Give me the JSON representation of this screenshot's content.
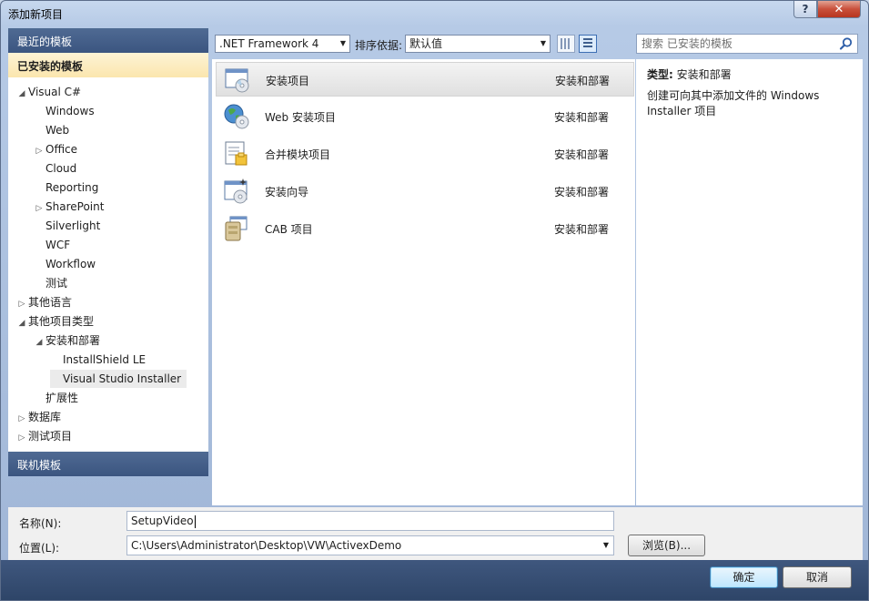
{
  "window": {
    "title": "添加新项目",
    "help_label": "?",
    "close_label": "✕"
  },
  "left": {
    "recent_header": "最近的模板",
    "installed_header": "已安装的模板",
    "online_header": "联机模板",
    "tree": [
      {
        "label": "Visual C#",
        "arrow": "◢",
        "level": 0
      },
      {
        "label": "Windows",
        "arrow": "",
        "level": 1
      },
      {
        "label": "Web",
        "arrow": "",
        "level": 1
      },
      {
        "label": "Office",
        "arrow": "▷",
        "level": 1
      },
      {
        "label": "Cloud",
        "arrow": "",
        "level": 1
      },
      {
        "label": "Reporting",
        "arrow": "",
        "level": 1
      },
      {
        "label": "SharePoint",
        "arrow": "▷",
        "level": 1
      },
      {
        "label": "Silverlight",
        "arrow": "",
        "level": 1
      },
      {
        "label": "WCF",
        "arrow": "",
        "level": 1
      },
      {
        "label": "Workflow",
        "arrow": "",
        "level": 1
      },
      {
        "label": "测试",
        "arrow": "",
        "level": 1
      },
      {
        "label": "其他语言",
        "arrow": "▷",
        "level": 0
      },
      {
        "label": "其他项目类型",
        "arrow": "◢",
        "level": 0
      },
      {
        "label": "安装和部署",
        "arrow": "◢",
        "level": 1
      },
      {
        "label": "InstallShield LE",
        "arrow": "",
        "level": 2
      },
      {
        "label": "Visual Studio Installer",
        "arrow": "",
        "level": 2,
        "selected": true
      },
      {
        "label": "扩展性",
        "arrow": "",
        "level": 1
      },
      {
        "label": "数据库",
        "arrow": "▷",
        "level": 0
      },
      {
        "label": "测试项目",
        "arrow": "▷",
        "level": 0
      }
    ]
  },
  "toolbar": {
    "framework": ".NET Framework 4",
    "sort_label": "排序依据:",
    "sort_value": "默认值"
  },
  "templates": [
    {
      "name": "安装项目",
      "category": "安装和部署",
      "icon": "setup-project-icon",
      "selected": true
    },
    {
      "name": "Web 安装项目",
      "category": "安装和部署",
      "icon": "web-setup-project-icon"
    },
    {
      "name": "合并模块项目",
      "category": "安装和部署",
      "icon": "merge-module-icon"
    },
    {
      "name": "安装向导",
      "category": "安装和部署",
      "icon": "setup-wizard-icon"
    },
    {
      "name": "CAB 项目",
      "category": "安装和部署",
      "icon": "cab-project-icon"
    }
  ],
  "search": {
    "placeholder": "搜索 已安装的模板"
  },
  "details": {
    "type_label": "类型:",
    "type_value": "安装和部署",
    "description": "创建可向其中添加文件的 Windows Installer 项目"
  },
  "form": {
    "name_label": "名称(N):",
    "name_value": "SetupVideo",
    "location_label": "位置(L):",
    "location_value": "C:\\Users\\Administrator\\Desktop\\VW\\ActivexDemo",
    "browse_label": "浏览(B)..."
  },
  "footer": {
    "ok_label": "确定",
    "cancel_label": "取消"
  }
}
